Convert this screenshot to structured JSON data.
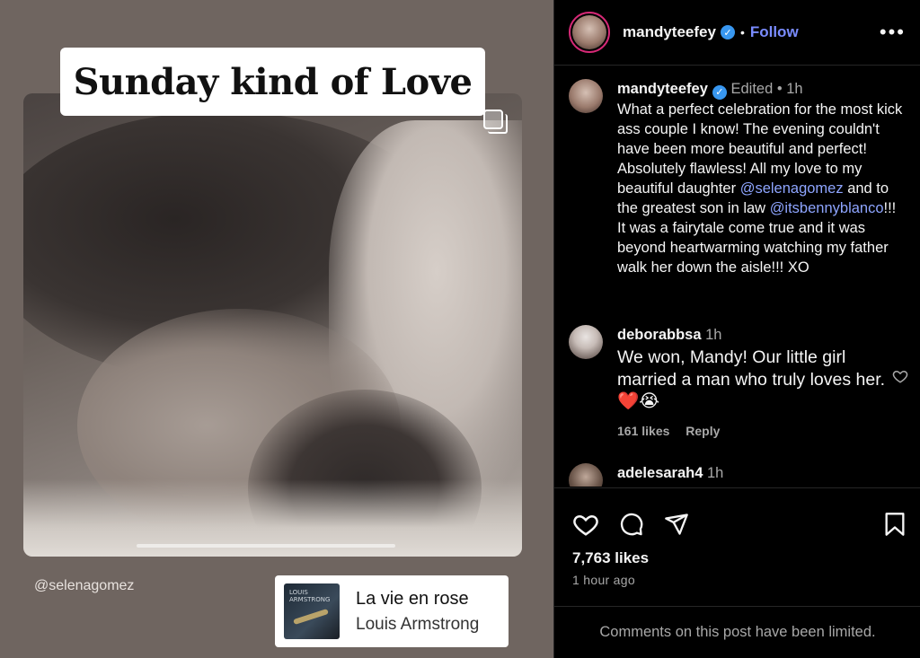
{
  "media": {
    "title_sticker": "Sunday kind of Love",
    "mention_tag": "@selenagomez",
    "music": {
      "song": "La vie en rose",
      "artist": "Louis Armstrong",
      "album_art_text_1": "LOUIS",
      "album_art_text_2": "ARMSTRONG"
    }
  },
  "header": {
    "username": "mandyteefey",
    "verified": true,
    "separator": "•",
    "follow_label": "Follow",
    "more_label": "•••"
  },
  "caption": {
    "username": "mandyteefey",
    "edited": "Edited",
    "separator": "•",
    "time": "1h",
    "text_part1": "What a perfect celebration for the most kick ass couple I know! The evening couldn't have been more beautiful and perfect! Absolutely flawless! All my love to my beautiful daughter ",
    "mention1": "@selenagomez",
    "text_part2": " and to the greatest son in law ",
    "mention2": "@itsbennyblanco",
    "text_part3": "!!! It was a fairytale come true and it was beyond heartwarming watching my father walk her down the aisle!!! XO"
  },
  "comments": [
    {
      "username": "deborabbsa",
      "time": "1h",
      "text": "We won, Mandy! Our little girl married a man who truly loves her. ❤️😭",
      "likes": "161 likes",
      "reply_label": "Reply"
    },
    {
      "username": "adelesarah4",
      "time": "1h"
    }
  ],
  "actions": {
    "like_icon": "heart-icon",
    "comment_icon": "comment-icon",
    "share_icon": "share-icon",
    "save_icon": "bookmark-icon",
    "likes_count": "7,763 likes",
    "posted_time": "1 hour ago"
  },
  "footer": {
    "limited_notice": "Comments on this post have been limited."
  },
  "colors": {
    "accent_link": "#8ea5ff",
    "follow": "#7a8cff",
    "verified": "#3897f0",
    "heart_red": "#e0245e"
  }
}
